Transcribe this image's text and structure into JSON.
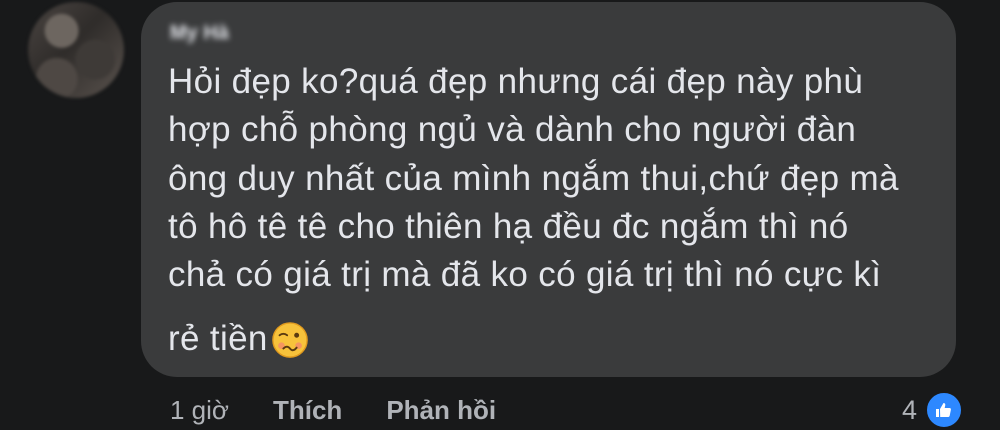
{
  "comment": {
    "author": "My Hà",
    "lines": [
      "Hỏi đẹp ko?quá đẹp nhưng cái đẹp này phù",
      "hợp chỗ phòng ngủ và dành cho người đàn",
      "ông duy nhất của mình ngắm thui,chứ đẹp mà",
      "tô hô tê tê cho thiên hạ đều đc ngắm thì nó",
      "chả có giá trị mà đã ko có giá trị thì nó cực kì"
    ],
    "last_line": "rẻ tiền",
    "emoji": "woozy-face-icon"
  },
  "actions": {
    "time": "1 giờ",
    "like_label": "Thích",
    "reply_label": "Phản hồi"
  },
  "reactions": {
    "count": "4",
    "icon": "like-icon",
    "badge_color": "#2d88ff"
  }
}
